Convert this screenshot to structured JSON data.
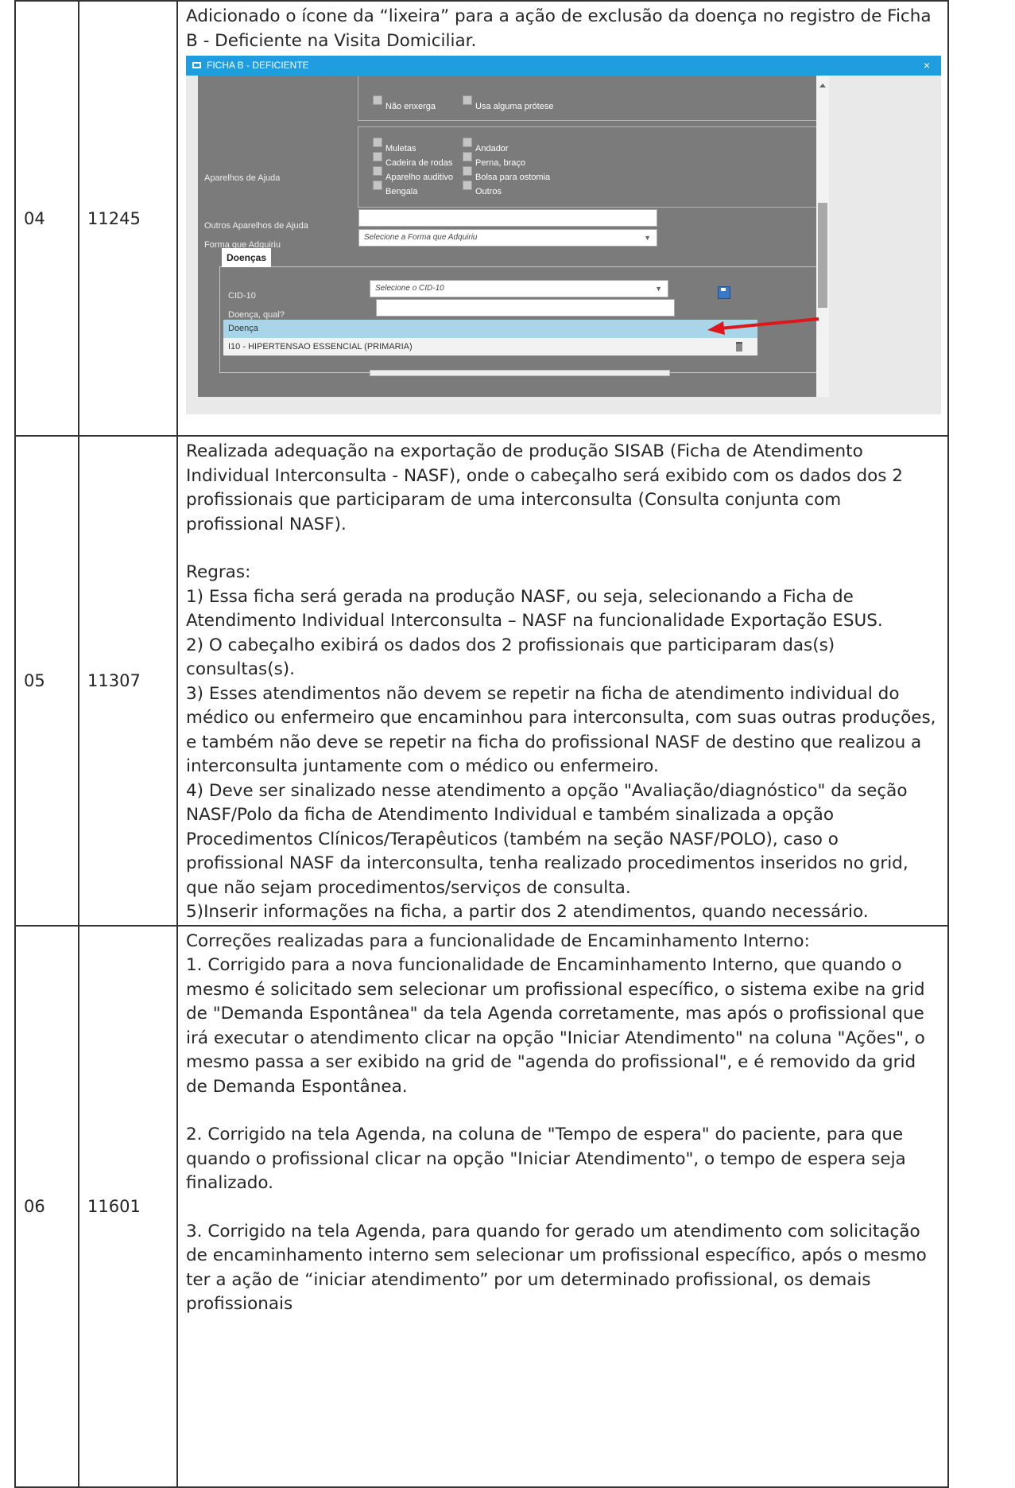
{
  "rows": [
    {
      "num": "04",
      "code": "11245",
      "paragraphs": [
        "Adicionado o ícone da “lixeira” para a ação de exclusão da doença no registro de Ficha B - Deficiente na Visita Domiciliar."
      ],
      "screenshot": {
        "title": "FICHA B - DEFICIENTE",
        "close": "×",
        "checkboxes_top": [
          "Não enxerga",
          "Usa alguma prótese"
        ],
        "checkboxes_help": [
          "Muletas",
          "Andador",
          "Cadeira de rodas",
          "Perna, braço",
          "Aparelho auditivo",
          "Bolsa para ostomia",
          "Bengala",
          "Outros"
        ],
        "label_help": "Aparelhos de Ajuda",
        "label_other_help": "Outros Aparelhos de Ajuda",
        "label_form": "Forma que Adquiriu",
        "form_placeholder": "Selecione a Forma que Adquiriu",
        "group_title": "Doenças",
        "label_cid": "CID-10",
        "cid_placeholder": "Selecione o CID-10",
        "label_disease": "Doença, qual?",
        "grid_header": "Doença",
        "grid_row": "I10 - HIPERTENSAO ESSENCIAL (PRIMARIA)",
        "dropdown_arrow": "▼",
        "trash_icon": "trash-icon",
        "save_icon": "save-icon",
        "arrow_color": "#e0161c",
        "title_color": "#1f9de0"
      }
    },
    {
      "num": "05",
      "code": "11307",
      "paragraphs": [
        "Realizada adequação na exportação de produção SISAB (Ficha de Atendimento Individual Interconsulta - NASF), onde o cabeçalho será exibido com os dados dos 2 profissionais que participaram de uma interconsulta (Consulta conjunta com profissional NASF).",
        "",
        "Regras:",
        "1) Essa ficha será gerada na produção NASF, ou seja, selecionando a Ficha de Atendimento Individual Interconsulta – NASF na funcionalidade Exportação ESUS.",
        "2) O cabeçalho exibirá os dados dos 2 profissionais que participaram das(s) consultas(s).",
        "3) Esses atendimentos não devem se repetir na ficha de atendimento individual do médico ou enfermeiro que encaminhou para interconsulta, com suas outras produções, e também não deve se repetir na ficha do profissional NASF de destino que realizou a interconsulta juntamente com o médico ou enfermeiro.",
        "4) Deve ser sinalizado nesse atendimento a opção \"Avaliação/diagnóstico\" da seção NASF/Polo da ficha de Atendimento Individual e também sinalizada a opção Procedimentos Clínicos/Terapêuticos (também na seção NASF/POLO), caso o profissional NASF da interconsulta, tenha realizado procedimentos inseridos no grid, que não sejam procedimentos/serviços de consulta.",
        "5)Inserir informações na ficha, a partir dos 2 atendimentos, quando necessário."
      ]
    },
    {
      "num": "06",
      "code": "11601",
      "paragraphs": [
        "Correções realizadas para a funcionalidade de Encaminhamento Interno:",
        "1. Corrigido para a nova funcionalidade de Encaminhamento Interno, que quando o mesmo é solicitado sem selecionar um profissional específico, o sistema exibe na grid de \"Demanda Espontânea\" da tela Agenda corretamente, mas após o profissional que irá executar o atendimento clicar na opção \"Iniciar Atendimento\" na coluna \"Ações\", o mesmo passa a ser exibido na grid de \"agenda do profissional\", e é removido da grid de Demanda Espontânea.",
        "",
        "2. Corrigido na tela Agenda, na coluna de \"Tempo de espera\" do paciente, para que quando o profissional clicar na opção \"Iniciar Atendimento\", o tempo de espera seja finalizado.",
        "",
        "3. Corrigido na tela Agenda, para quando for gerado um atendimento com solicitação de encaminhamento interno sem selecionar um profissional específico, após o mesmo ter a ação de “iniciar atendimento” por um determinado profissional, os demais profissionais"
      ]
    }
  ]
}
